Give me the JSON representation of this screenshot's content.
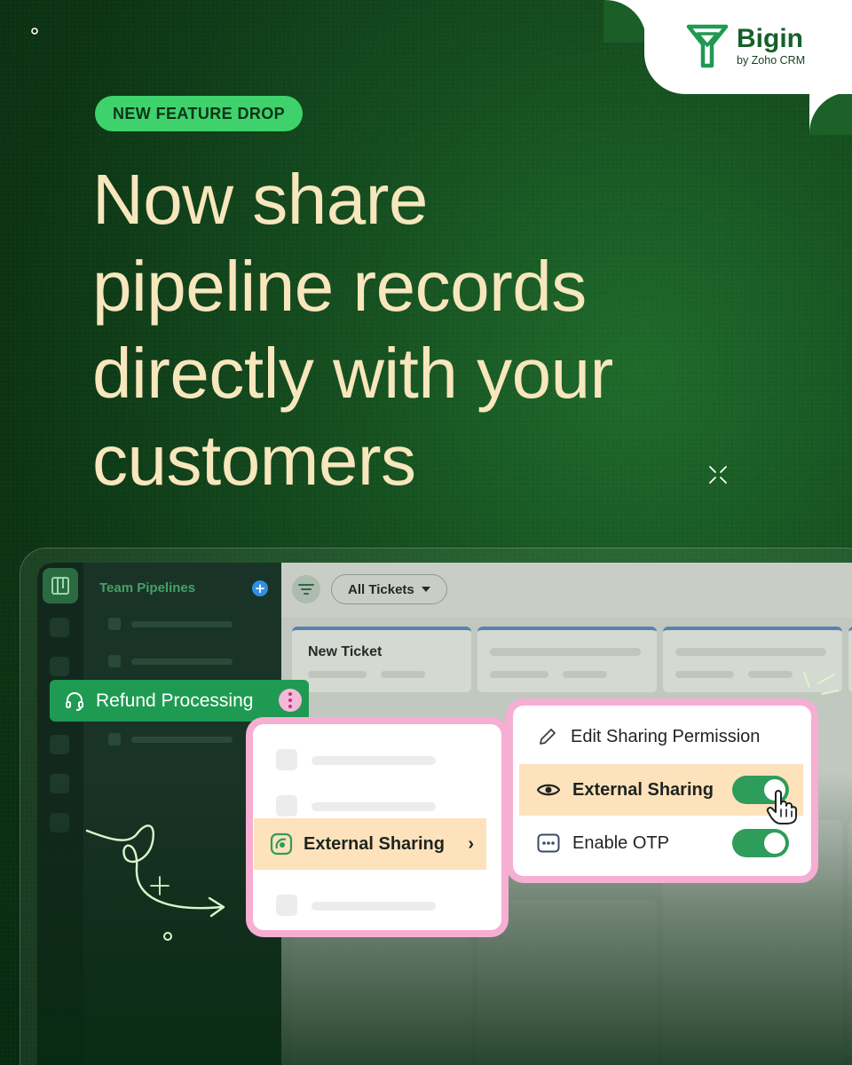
{
  "brand": {
    "name": "Bigin",
    "tagline": "by Zoho CRM",
    "color": "#16612a"
  },
  "badge": "NEW FEATURE DROP",
  "headline": {
    "lines": [
      "Now share",
      "pipeline records",
      "directly with your",
      "customers"
    ]
  },
  "app": {
    "sidebar": {
      "title": "Team Pipelines",
      "add_icon": "plus-icon"
    },
    "toolbar": {
      "filter_icon": "filter-icon",
      "view_select": "All Tickets"
    },
    "columns": [
      {
        "title": "New Ticket"
      }
    ],
    "record_pill": {
      "label": "Refund Processing",
      "icon": "headset-icon"
    },
    "context_menu": {
      "active_item": "External Sharing"
    },
    "sharing_menu": {
      "items": [
        {
          "label": "Edit Sharing Permission",
          "icon": "pencil-icon"
        },
        {
          "label": "External Sharing",
          "icon": "eye-icon",
          "toggle_on": true
        },
        {
          "label": "Enable OTP",
          "icon": "otp-icon",
          "toggle_on": true
        }
      ]
    }
  },
  "colors": {
    "accent_green": "#3fd26c",
    "headline": "#f8e6bd",
    "menu_border": "#f6aed3",
    "menu_highlight": "#fde2bb",
    "toggle_on": "#2e9c5a"
  }
}
